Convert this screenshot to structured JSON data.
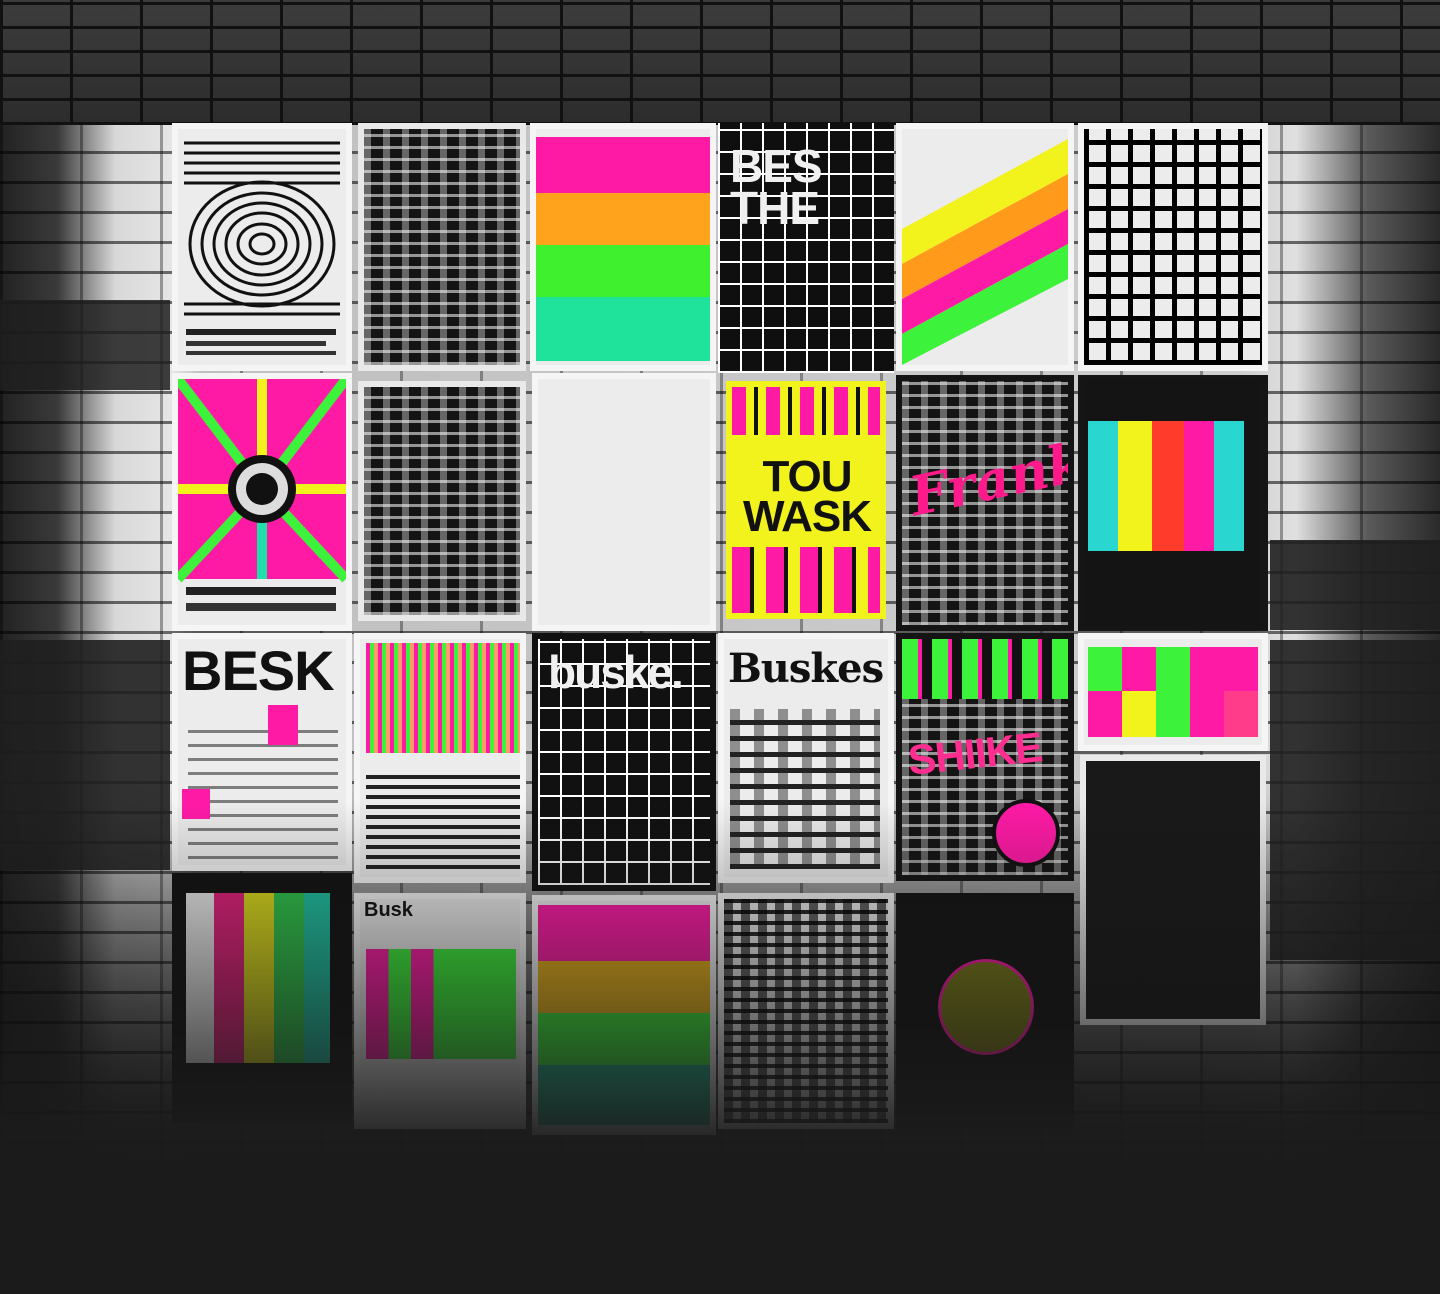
{
  "scene": {
    "description_colors": {
      "magenta": "#ff1aa6",
      "orange": "#ff9a1a",
      "yellow": "#f2f21c",
      "green": "#3df23a",
      "teal": "#1fe0a8",
      "cyan": "#29d6d0",
      "red": "#ff3c2c",
      "black": "#111111",
      "paper": "#ececec"
    }
  },
  "posters": {
    "p04_text": "BES\nTHE",
    "p10_text": "TOU\nWASK",
    "p11_text": "Frankie",
    "p13_text": "BESK",
    "p15_text": "buske.",
    "p16_text": "Buskes",
    "p17_text": "SHIIKE",
    "p20_text": "Busk"
  }
}
